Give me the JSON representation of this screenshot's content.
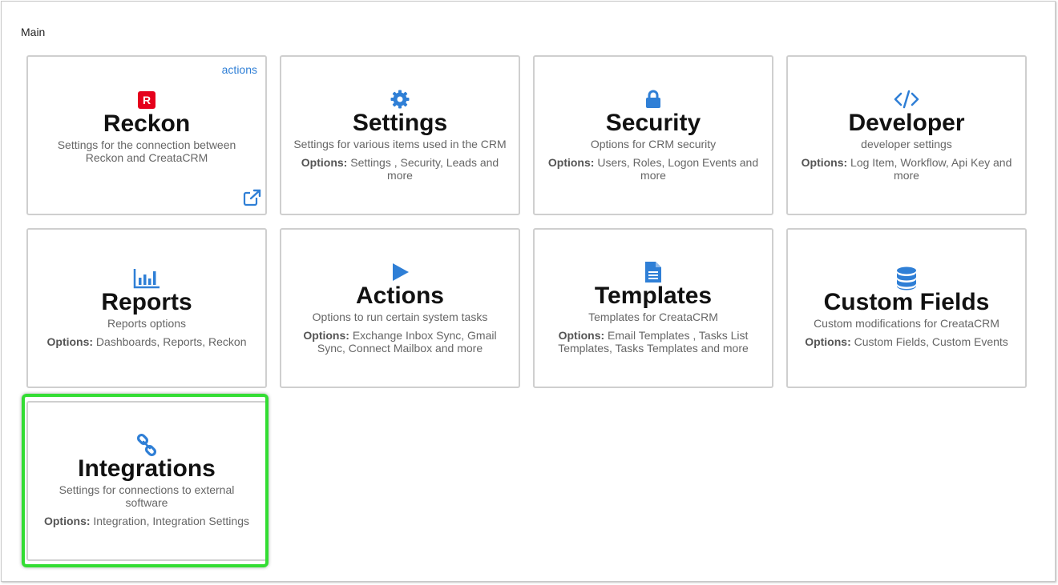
{
  "section_title": "Main",
  "colors": {
    "accent": "#2f7fd6",
    "reckon_red": "#e5001c",
    "highlight": "#33dd33"
  },
  "tiles": [
    {
      "icon": "reckon-logo-icon",
      "icon_text": "R",
      "title": "Reckon",
      "description": "Settings for the connection between Reckon and CreataCRM",
      "actions_link": "actions",
      "external_icon": "external-link-icon"
    },
    {
      "icon": "gear-icon",
      "title": "Settings",
      "description": "Settings for various items used in the CRM",
      "options_label": "Options:",
      "options_text": " Settings , Security, Leads and more"
    },
    {
      "icon": "lock-icon",
      "title": "Security",
      "description": "Options for CRM security",
      "options_label": "Options:",
      "options_text": " Users, Roles, Logon Events and more"
    },
    {
      "icon": "code-icon",
      "title": "Developer",
      "description": "developer settings",
      "options_label": "Options:",
      "options_text": " Log Item, Workflow, Api Key and more"
    },
    {
      "icon": "bar-chart-icon",
      "title": "Reports",
      "description": "Reports options",
      "options_label": "Options:",
      "options_text": " Dashboards, Reports, Reckon"
    },
    {
      "icon": "play-icon",
      "title": "Actions",
      "description": "Options to run certain system tasks",
      "options_label": "Options:",
      "options_text": " Exchange Inbox Sync, Gmail Sync, Connect Mailbox and more"
    },
    {
      "icon": "document-icon",
      "title": "Templates",
      "description": "Templates for CreataCRM",
      "options_label": "Options:",
      "options_text": " Email Templates , Tasks List Templates, Tasks Templates and more"
    },
    {
      "icon": "database-icon",
      "title": "Custom Fields",
      "description": "Custom modifications for CreataCRM",
      "options_label": "Options:",
      "options_text": " Custom Fields, Custom Events"
    },
    {
      "icon": "link-icon",
      "title": "Integrations",
      "description": "Settings for connections to external software",
      "options_label": "Options:",
      "options_text": " Integration, Integration Settings"
    }
  ]
}
